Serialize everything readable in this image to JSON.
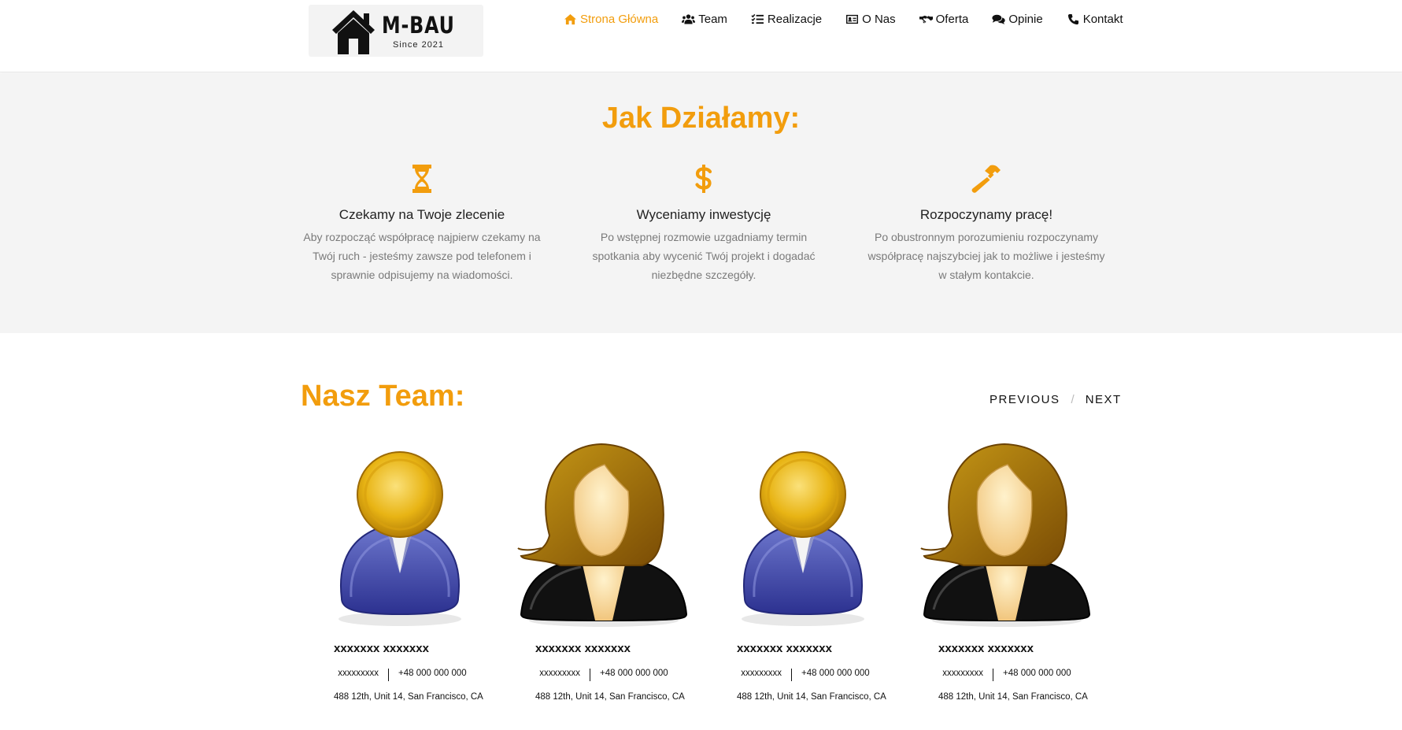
{
  "brand": {
    "name": "M-BAU",
    "since": "Since 2021"
  },
  "nav": {
    "items": [
      {
        "label": "Strona Główna",
        "icon": "home-icon",
        "active": true
      },
      {
        "label": "Team",
        "icon": "users-icon",
        "active": false
      },
      {
        "label": "Realizacje",
        "icon": "list-check-icon",
        "active": false
      },
      {
        "label": "O Nas",
        "icon": "id-card-icon",
        "active": false
      },
      {
        "label": "Oferta",
        "icon": "handshake-icon",
        "active": false
      },
      {
        "label": "Opinie",
        "icon": "comments-icon",
        "active": false
      },
      {
        "label": "Kontakt",
        "icon": "phone-icon",
        "active": false
      }
    ]
  },
  "how": {
    "title": "Jak Działamy:",
    "steps": [
      {
        "icon": "hourglass-icon",
        "title": "Czekamy na Twoje zlecenie",
        "text": "Aby rozpocząć współpracę najpierw czekamy na Twój ruch - jesteśmy zawsze pod telefonem i sprawnie odpisujemy na wiadomości."
      },
      {
        "icon": "dollar-icon",
        "title": "Wyceniamy inwestycję",
        "text": "Po wstępnej rozmowie uzgadniamy termin spotkania aby wycenić Twój projekt i dogadać niezbędne szczegóły."
      },
      {
        "icon": "hammer-icon",
        "title": "Rozpoczynamy pracę!",
        "text": "Po obustronnym porozumieniu rozpoczynamy współpracę najszybciej jak to możliwe i jesteśmy w stałym kontakcie."
      }
    ]
  },
  "team": {
    "title": "Nasz Team:",
    "previous_label": "PREVIOUS",
    "separator": "/",
    "next_label": "NEXT",
    "members": [
      {
        "avatar": "male-avatar-icon",
        "name": "xxxxxxx xxxxxxx",
        "role": "xxxxxxxxx",
        "phone": "+48 000 000 000",
        "address": "488 12th, Unit 14, San Francisco, CA"
      },
      {
        "avatar": "female-avatar-icon",
        "name": "xxxxxxx xxxxxxx",
        "role": "xxxxxxxxx",
        "phone": "+48 000 000 000",
        "address": "488 12th, Unit 14, San Francisco, CA"
      },
      {
        "avatar": "male-avatar-icon",
        "name": "xxxxxxx xxxxxxx",
        "role": "xxxxxxxxx",
        "phone": "+48 000 000 000",
        "address": "488 12th, Unit 14, San Francisco, CA"
      },
      {
        "avatar": "female-avatar-icon",
        "name": "xxxxxxx xxxxxxx",
        "role": "xxxxxxxxx",
        "phone": "+48 000 000 000",
        "address": "488 12th, Unit 14, San Francisco, CA"
      }
    ]
  },
  "colors": {
    "accent": "#f29d0d",
    "section_bg": "#f4f4f4",
    "text": "#111111",
    "muted": "#7a7a7a"
  }
}
